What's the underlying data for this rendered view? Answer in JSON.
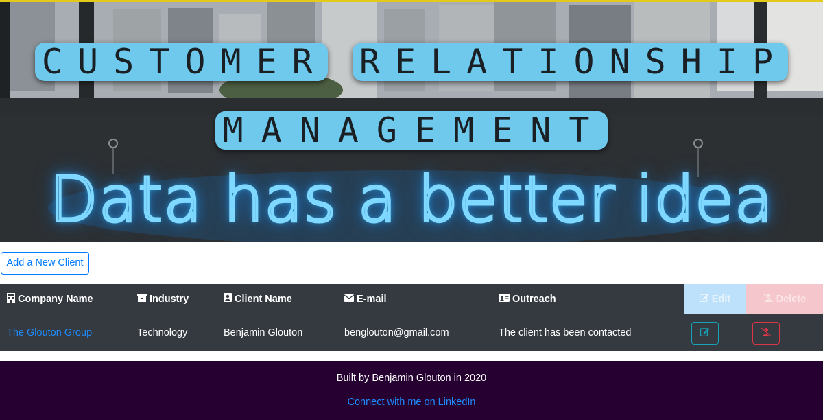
{
  "hero": {
    "title_words": [
      "CUSTOMER",
      "RELATIONSHIP"
    ],
    "title_line2": "MANAGEMENT",
    "neon_text": "Data has a better idea"
  },
  "add_button": {
    "label": "Add a New Client"
  },
  "table": {
    "headers": {
      "company": "Company Name",
      "industry": "Industry",
      "client": "Client Name",
      "email": "E-mail",
      "outreach": "Outreach",
      "edit": "Edit",
      "delete": "Delete"
    },
    "header_icons": {
      "company": "building-icon",
      "industry": "archive-icon",
      "client": "user-card-icon",
      "email": "envelope-icon",
      "outreach": "id-card-icon",
      "edit": "edit-icon",
      "delete": "user-slash-icon"
    },
    "rows": [
      {
        "company": "The Glouton Group",
        "industry": "Technology",
        "client": "Benjamin Glouton",
        "email": "benglouton@gmail.com",
        "outreach": "The client has been contacted"
      }
    ]
  },
  "footer": {
    "built_by": "Built by Benjamin Glouton in 2020",
    "link_text": "Connect with me on LinkedIn"
  },
  "colors": {
    "accent": "#007bff",
    "table_bg": "#343a40",
    "footer_bg": "#250031",
    "title_box": "#6ec9ec",
    "edit": "#17a2b8",
    "delete": "#dc3545"
  }
}
